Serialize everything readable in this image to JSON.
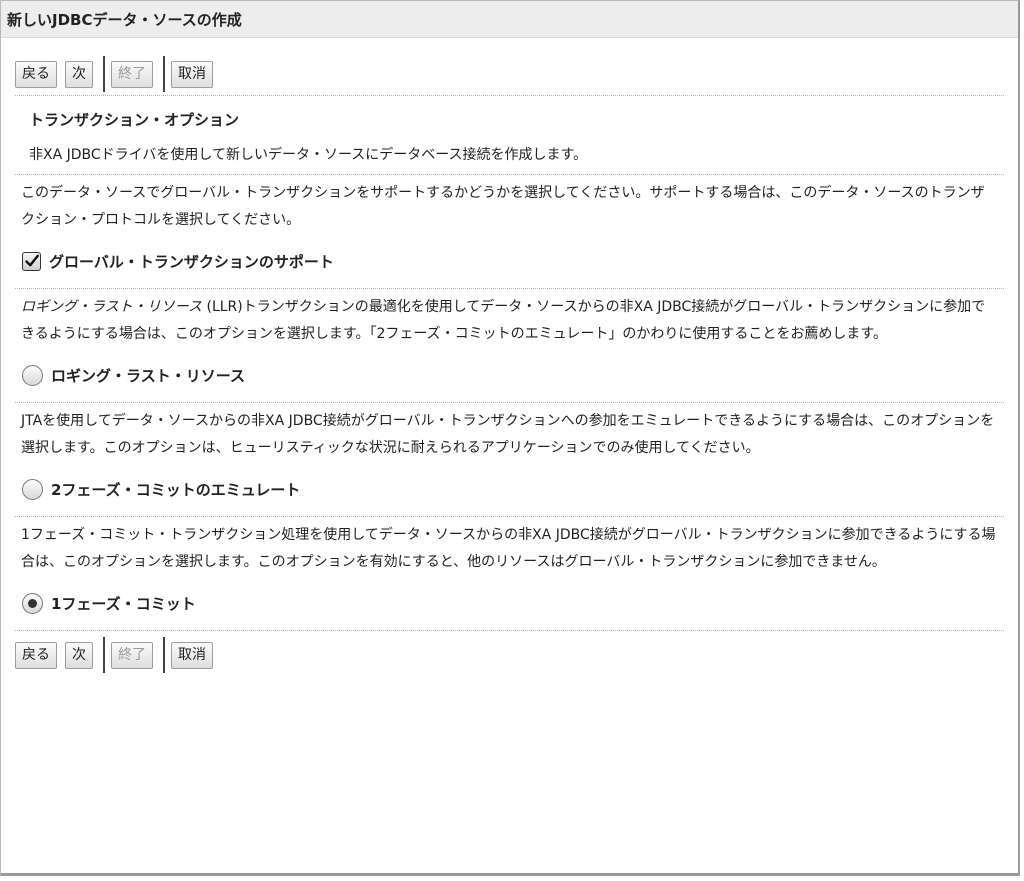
{
  "window": {
    "title": "新しいJDBCデータ・ソースの作成"
  },
  "toolbar": {
    "back": "戻る",
    "next": "次",
    "finish": "終了",
    "cancel": "取消"
  },
  "section": {
    "title": "トランザクション・オプション",
    "description": "非XA JDBCドライバを使用して新しいデータ・ソースにデータベース接続を作成します。"
  },
  "global": {
    "text": "このデータ・ソースでグローバル・トランザクションをサポートするかどうかを選択してください。サポートする場合は、このデータ・ソースのトランザクション・プロトコルを選択してください。",
    "label": "グローバル・トランザクションのサポート",
    "checked": true
  },
  "llr": {
    "text_italic": "ロギング・ラスト・リソース",
    "text": " (LLR)トランザクションの最適化を使用してデータ・ソースからの非XA JDBC接続がグローバル・トランザクションに参加できるようにする場合は、このオプションを選択します。「2フェーズ・コミットのエミュレート」のかわりに使用することをお薦めします。",
    "label": "ロギング・ラスト・リソース"
  },
  "emulate": {
    "text": "JTAを使用してデータ・ソースからの非XA JDBC接続がグローバル・トランザクションへの参加をエミュレートできるようにする場合は、このオプションを選択します。このオプションは、ヒューリスティックな状況に耐えられるアプリケーションでのみ使用してください。",
    "label": "2フェーズ・コミットのエミュレート"
  },
  "onephase": {
    "text": "1フェーズ・コミット・トランザクション処理を使用してデータ・ソースからの非XA JDBC接続がグローバル・トランザクションに参加できるようにする場合は、このオプションを選択します。このオプションを有効にすると、他のリソースはグローバル・トランザクションに参加できません。",
    "label": "1フェーズ・コミット"
  },
  "selected_protocol": "1フェーズ・コミット"
}
